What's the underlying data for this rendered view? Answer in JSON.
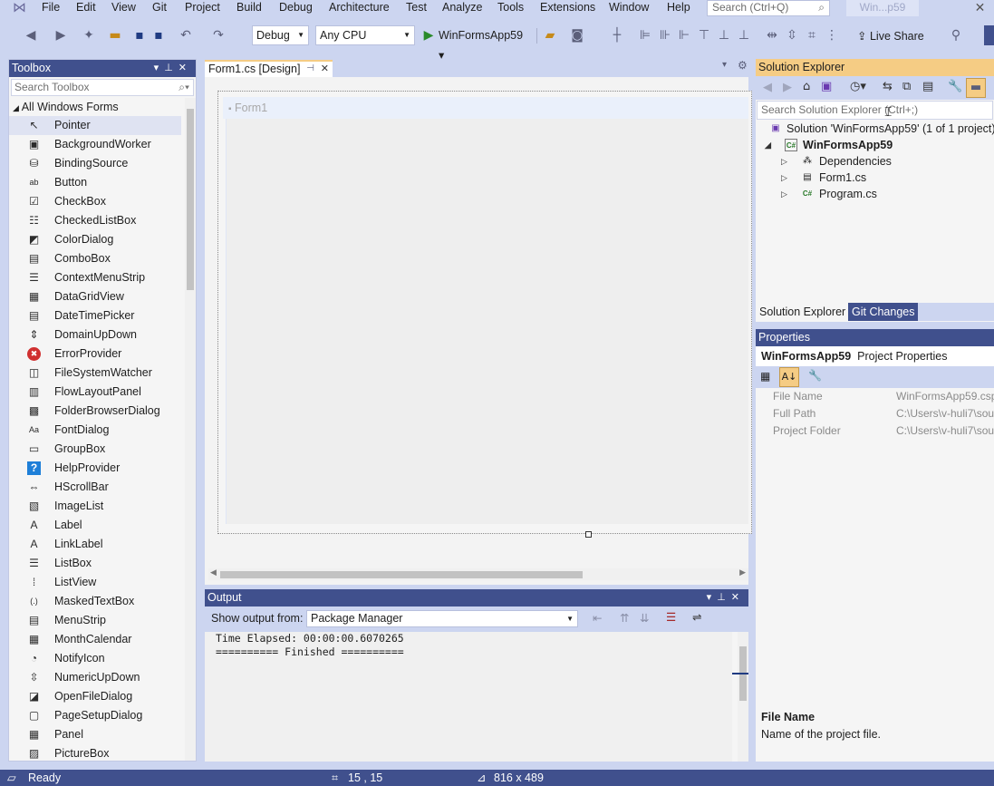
{
  "menubar": {
    "logo_icon": "visual-studio-logo-icon",
    "items": [
      "File",
      "Edit",
      "View",
      "Git",
      "Project",
      "Build",
      "Debug",
      "Architecture",
      "Test",
      "Analyze",
      "Tools",
      "Extensions",
      "Window",
      "Help"
    ],
    "search_placeholder": "Search (Ctrl+Q)",
    "window_title": "Win...p59"
  },
  "toolbar": {
    "config": "Debug",
    "platform": "Any CPU",
    "start_label": "WinFormsApp59",
    "live_share": "Live Share"
  },
  "toolbox": {
    "title": "Toolbox",
    "search_placeholder": "Search Toolbox",
    "group": "All Windows Forms",
    "items": [
      {
        "label": "Pointer",
        "icon": "pointer-icon",
        "glyph": "↖"
      },
      {
        "label": "BackgroundWorker",
        "icon": "backgroundworker-icon",
        "glyph": "▣"
      },
      {
        "label": "BindingSource",
        "icon": "bindingsource-icon",
        "glyph": "⛁"
      },
      {
        "label": "Button",
        "icon": "button-icon",
        "glyph": "ab"
      },
      {
        "label": "CheckBox",
        "icon": "checkbox-icon",
        "glyph": "☑"
      },
      {
        "label": "CheckedListBox",
        "icon": "checkedlistbox-icon",
        "glyph": "☷"
      },
      {
        "label": "ColorDialog",
        "icon": "colordialog-icon",
        "glyph": "◩"
      },
      {
        "label": "ComboBox",
        "icon": "combobox-icon",
        "glyph": "▤"
      },
      {
        "label": "ContextMenuStrip",
        "icon": "contextmenustrip-icon",
        "glyph": "☰"
      },
      {
        "label": "DataGridView",
        "icon": "datagridview-icon",
        "glyph": "▦"
      },
      {
        "label": "DateTimePicker",
        "icon": "datetimepicker-icon",
        "glyph": "▤"
      },
      {
        "label": "DomainUpDown",
        "icon": "domainupdown-icon",
        "glyph": "⇕"
      },
      {
        "label": "ErrorProvider",
        "icon": "errorprovider-icon",
        "glyph": "✖"
      },
      {
        "label": "FileSystemWatcher",
        "icon": "filesystemwatcher-icon",
        "glyph": "◫"
      },
      {
        "label": "FlowLayoutPanel",
        "icon": "flowlayoutpanel-icon",
        "glyph": "▥"
      },
      {
        "label": "FolderBrowserDialog",
        "icon": "folderbrowserdialog-icon",
        "glyph": "▩"
      },
      {
        "label": "FontDialog",
        "icon": "fontdialog-icon",
        "glyph": "Aa"
      },
      {
        "label": "GroupBox",
        "icon": "groupbox-icon",
        "glyph": "▭"
      },
      {
        "label": "HelpProvider",
        "icon": "helpprovider-icon",
        "glyph": "?"
      },
      {
        "label": "HScrollBar",
        "icon": "hscrollbar-icon",
        "glyph": "⇔"
      },
      {
        "label": "ImageList",
        "icon": "imagelist-icon",
        "glyph": "▧"
      },
      {
        "label": "Label",
        "icon": "label-icon",
        "glyph": "A"
      },
      {
        "label": "LinkLabel",
        "icon": "linklabel-icon",
        "glyph": "A"
      },
      {
        "label": "ListBox",
        "icon": "listbox-icon",
        "glyph": "☰"
      },
      {
        "label": "ListView",
        "icon": "listview-icon",
        "glyph": "⁞"
      },
      {
        "label": "MaskedTextBox",
        "icon": "maskedtextbox-icon",
        "glyph": "(.)"
      },
      {
        "label": "MenuStrip",
        "icon": "menustrip-icon",
        "glyph": "▤"
      },
      {
        "label": "MonthCalendar",
        "icon": "monthcalendar-icon",
        "glyph": "▦"
      },
      {
        "label": "NotifyIcon",
        "icon": "notifyicon-icon",
        "glyph": "◔"
      },
      {
        "label": "NumericUpDown",
        "icon": "numericupdown-icon",
        "glyph": "⇳"
      },
      {
        "label": "OpenFileDialog",
        "icon": "openfiledialog-icon",
        "glyph": "◪"
      },
      {
        "label": "PageSetupDialog",
        "icon": "pagesetupdialog-icon",
        "glyph": "▢"
      },
      {
        "label": "Panel",
        "icon": "panel-icon",
        "glyph": "▦"
      },
      {
        "label": "PictureBox",
        "icon": "picturebox-icon",
        "glyph": "▨"
      }
    ]
  },
  "document": {
    "tab_label": "Form1.cs [Design]",
    "form_title": "Form1"
  },
  "output": {
    "title": "Output",
    "show_from_label": "Show output from:",
    "source": "Package Manager",
    "lines": [
      "Time Elapsed: 00:00:00.6070265",
      "========== Finished =========="
    ]
  },
  "solution_explorer": {
    "title": "Solution Explorer",
    "search_placeholder": "Search Solution Explorer (Ctrl+;)",
    "solution": "Solution 'WinFormsApp59' (1 of 1 project)",
    "project": "WinFormsApp59",
    "children": [
      "Dependencies",
      "Form1.cs",
      "Program.cs"
    ],
    "tabs": [
      "Solution Explorer",
      "Git Changes"
    ]
  },
  "properties": {
    "title": "Properties",
    "object_name": "WinFormsApp59",
    "object_type": "Project Properties",
    "rows": [
      {
        "name": "File Name",
        "value": "WinFormsApp59.csp"
      },
      {
        "name": "Full Path",
        "value": "C:\\Users\\v-huli7\\sou"
      },
      {
        "name": "Project Folder",
        "value": "C:\\Users\\v-huli7\\sou"
      }
    ],
    "desc_title": "File Name",
    "desc_text": "Name of the project file."
  },
  "statusbar": {
    "ready": "Ready",
    "position": "15 , 15",
    "size": "816 x 489"
  }
}
